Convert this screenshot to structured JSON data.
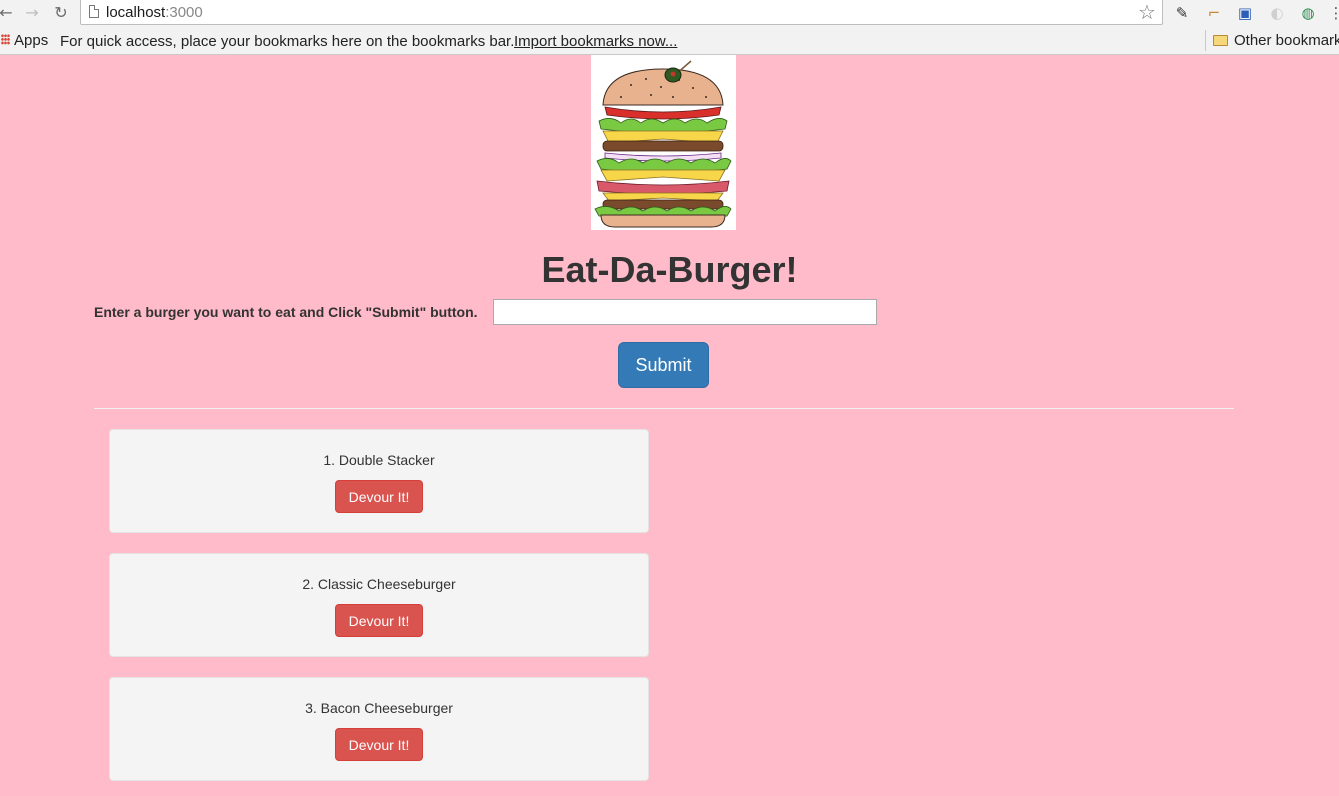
{
  "browser": {
    "url_host": "localhost",
    "url_port": ":3000",
    "bookmarks": {
      "apps_label": "Apps",
      "hint": "For quick access, place your bookmarks here on the bookmarks bar.",
      "import_link": "Import bookmarks now...",
      "other_label": "Other bookmarks"
    }
  },
  "page": {
    "title": "Eat-Da-Burger!",
    "form": {
      "label": "Enter a burger you want to eat and Click \"Submit\" button.",
      "input_value": "",
      "submit_label": "Submit"
    },
    "burgers": [
      {
        "name": "1. Double Stacker",
        "button": "Devour It!"
      },
      {
        "name": "2. Classic Cheeseburger",
        "button": "Devour It!"
      },
      {
        "name": "3. Bacon Cheeseburger",
        "button": "Devour It!"
      }
    ]
  },
  "colors": {
    "page_background": "#ffbbc9",
    "primary_button": "#337ab7",
    "danger_button": "#d9534f"
  }
}
